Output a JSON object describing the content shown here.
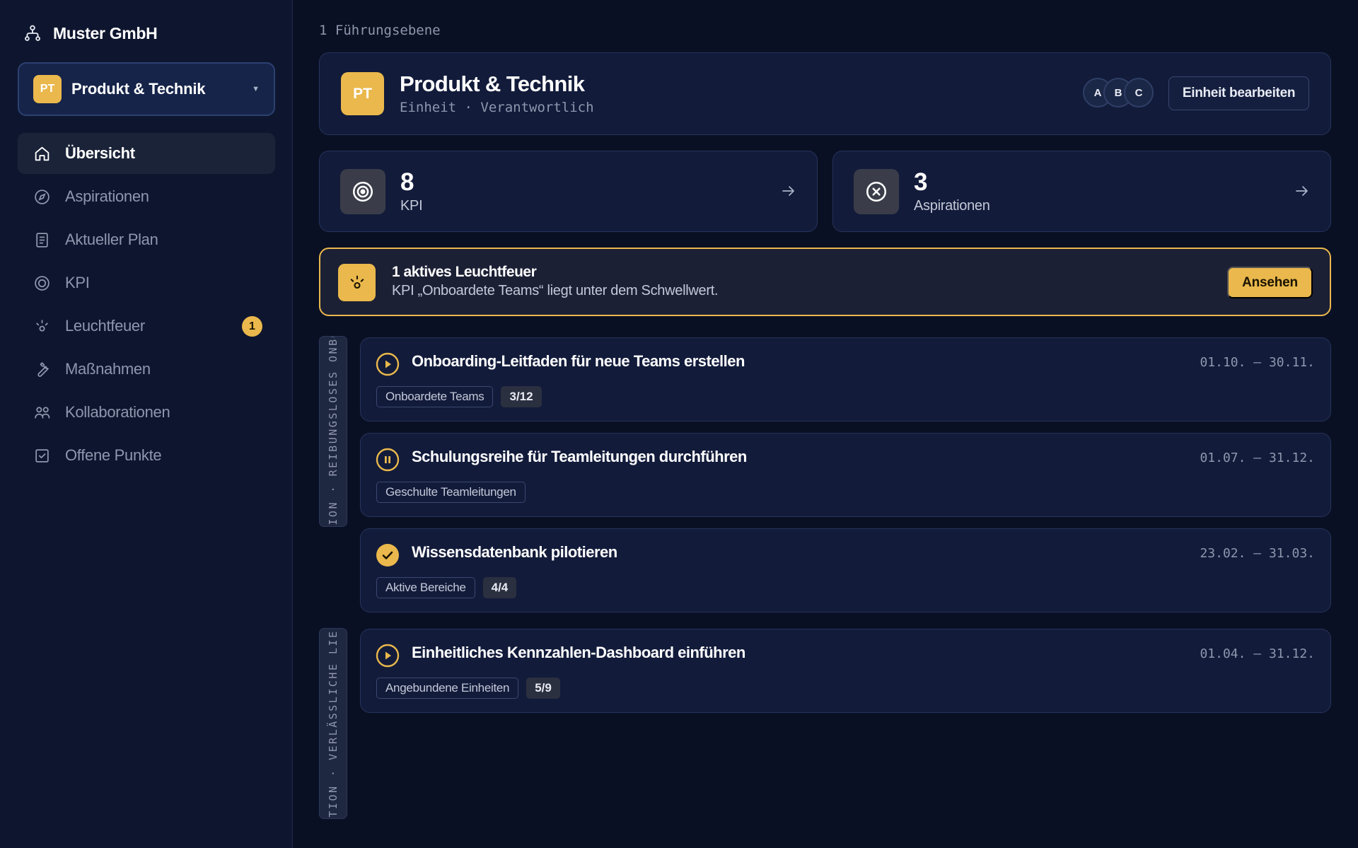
{
  "org": {
    "name": "Muster GmbH",
    "icon": "org-chart-icon"
  },
  "unit_select": {
    "initials": "PT",
    "name": "Produkt & Technik"
  },
  "nav": [
    {
      "label": "Übersicht",
      "icon": "home-icon",
      "active": true
    },
    {
      "label": "Aspirationen",
      "icon": "compass-icon"
    },
    {
      "label": "Aktueller Plan",
      "icon": "document-icon"
    },
    {
      "label": "KPI",
      "icon": "target-icon"
    },
    {
      "label": "Leuchtfeuer",
      "icon": "beacon-icon",
      "badge": "1"
    },
    {
      "label": "Maßnahmen",
      "icon": "wrench-icon"
    },
    {
      "label": "Kollaborationen",
      "icon": "users-icon"
    },
    {
      "label": "Offene Punkte",
      "icon": "checkbox-icon"
    }
  ],
  "breadcrumb": "1 Führungsebene",
  "header": {
    "initials": "PT",
    "title": "Produkt & Technik",
    "subtitle": "Einheit · Verantwortlich",
    "avatars": [
      "A",
      "B",
      "C"
    ],
    "edit_label": "Einheit bearbeiten"
  },
  "stats": [
    {
      "value": "8",
      "label": "KPI",
      "icon": "target-icon"
    },
    {
      "value": "3",
      "label": "Aspirationen",
      "icon": "compass-icon"
    }
  ],
  "alert": {
    "title": "1 aktives Leuchtfeuer",
    "text": "KPI „Onboardete Teams“ liegt unter dem Schwellwert.",
    "button": "Ansehen",
    "icon": "beacon-icon"
  },
  "groups": [
    {
      "label": "TION · REIBUNGSLOSES ONBO"
    },
    {
      "label": "ATION · VERLÄSSLICHE LIEF"
    }
  ],
  "tasks": [
    {
      "title": "Onboarding-Leitfaden für neue Teams erstellen",
      "date": "01.10. – 30.11.",
      "tag": "Onboardete Teams",
      "count": "3/12",
      "status": "play-icon"
    },
    {
      "title": "Schulungsreihe für Teamleitungen durchführen",
      "date": "01.07. – 31.12.",
      "tag": "Geschulte Teamleitungen",
      "count": "",
      "status": "pause-icon"
    },
    {
      "title": "Wissensdatenbank pilotieren",
      "date": "23.02. – 31.03.",
      "tag": "Aktive Bereiche",
      "count": "4/4",
      "status": "check-icon"
    },
    {
      "title": "Einheitliches Kennzahlen-Dashboard einführen",
      "date": "01.04. – 31.12.",
      "tag": "Angebundene Einheiten",
      "count": "5/9",
      "status": "play-icon"
    }
  ],
  "colors": {
    "accent": "#eab84c",
    "background": "#0a1024",
    "sidebar": "#0e162f",
    "card": "#121b3a"
  }
}
